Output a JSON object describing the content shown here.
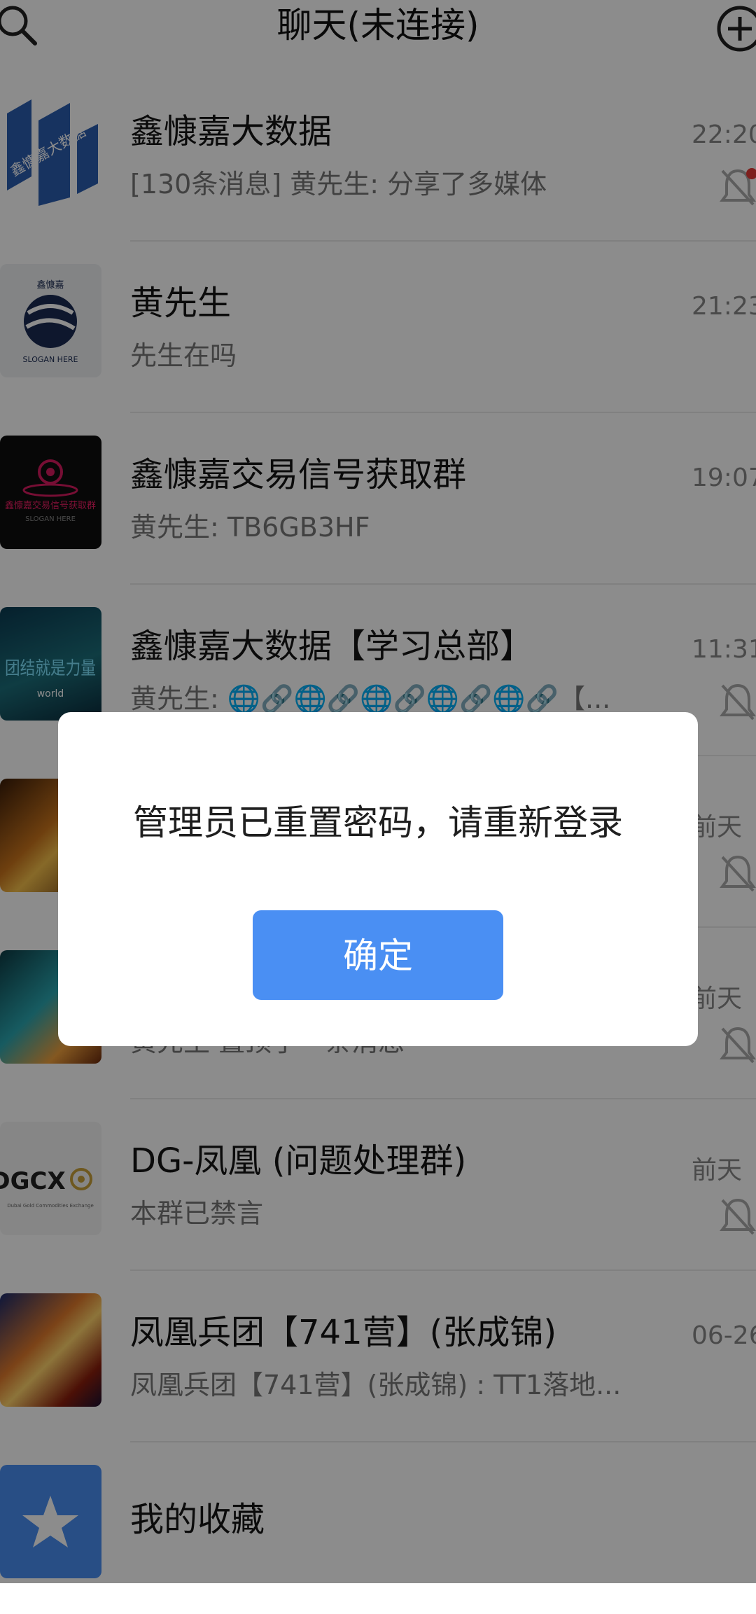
{
  "header": {
    "title": "聊天(未连接)"
  },
  "chats": [
    {
      "name": "鑫慷嘉大数据",
      "preview": "[130条消息] 黄先生: 分享了多媒体",
      "time": "22:20",
      "avatar_text": "鑫慷嘉大数据",
      "avatar_sub": ""
    },
    {
      "name": "黄先生",
      "preview": "先生在吗",
      "time": "21:23",
      "avatar_text": "鑫慷嘉",
      "avatar_sub": "SLOGAN HERE"
    },
    {
      "name": "鑫慷嘉交易信号获取群",
      "preview": "黄先生: TB6GB3HF",
      "time": "19:07",
      "avatar_text": "鑫慷嘉交易信号获取群",
      "avatar_sub": "SLOGAN HERE"
    },
    {
      "name": "鑫慷嘉大数据【学习总部】",
      "preview": "黄先生: 🌐🔗🌐🔗🌐🔗🌐🔗🌐🔗【...",
      "time": "11:31",
      "avatar_text": "团结就是力量",
      "avatar_sub": "world"
    },
    {
      "name": "",
      "preview": "",
      "time": "前天",
      "avatar_text": "",
      "avatar_sub": ""
    },
    {
      "name": "",
      "preview": "黄先生 置顶了一条消息",
      "time": "前天",
      "avatar_text": "",
      "avatar_sub": ""
    },
    {
      "name": "DG-凤凰 (问题处理群)",
      "preview": "本群已禁言",
      "time": "前天",
      "avatar_text": "DGCX",
      "avatar_sub": "Dubai Gold Commodities Exchange"
    },
    {
      "name": "凤凰兵团【741营】(张成锦)",
      "preview": "凤凰兵团【741营】(张成锦) : TT1落地...",
      "time": "06-26",
      "avatar_text": "",
      "avatar_sub": ""
    },
    {
      "name": "我的收藏",
      "preview": "",
      "time": "",
      "avatar_text": "",
      "avatar_sub": ""
    }
  ],
  "dialog": {
    "message": "管理员已重置密码，请重新登录",
    "confirm_label": "确定"
  },
  "colors": {
    "accent": "#4a8ff3",
    "overlay": "rgba(0,0,0,0.45)"
  }
}
